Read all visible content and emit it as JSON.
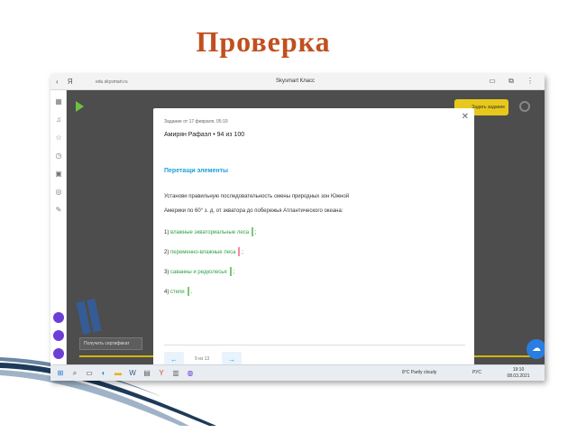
{
  "slide": {
    "title": "Проверка"
  },
  "browser": {
    "nav_glyphs": "‹ Я",
    "url": "edu.skysmart.ru",
    "tab_title": "Skysmart Класс",
    "window_controls": "▭ ⧉ ⋮"
  },
  "site": {
    "yellow_button": "Задать задание",
    "certificate_button": "Получить сертификат",
    "chat_icon": "chat-bubble-icon"
  },
  "modal": {
    "meta": "Задание от 17 февраля, 05:10",
    "student": "Амирян Рафаэл • 94 из 100",
    "task_type": "Перетащи элементы",
    "instruction_line1": "Установи правильную последовательность смены природных зон Южной",
    "instruction_line2": "Америки по 60° з. д. от экватора до побережья Атлантического океана:",
    "answers": [
      {
        "num": "1)",
        "term": "влажные экваториальные леса",
        "suffix": ";",
        "status": "correct"
      },
      {
        "num": "2)",
        "term": "переменно-влажные леса",
        "suffix": ";",
        "status": "wrong"
      },
      {
        "num": "3)",
        "term": "саванны и редколесья",
        "suffix": ";",
        "status": "correct"
      },
      {
        "num": "4)",
        "term": "степи",
        "suffix": ".",
        "status": "correct"
      }
    ],
    "pagination": "9 из 13",
    "prev_label": "←",
    "next_label": "→",
    "close_label": "✕"
  },
  "taskbar": {
    "weather": "8°C Partly cloudy",
    "lang": "РУС",
    "time": "19:10",
    "date": "08.03.2021"
  },
  "colors": {
    "title": "#c0501f",
    "task_accent": "#1a9fd9",
    "term_green": "#2ea043",
    "mark_ok": "#7bc96f",
    "mark_bad": "#f28aa0",
    "yellow": "#e8c81a"
  }
}
